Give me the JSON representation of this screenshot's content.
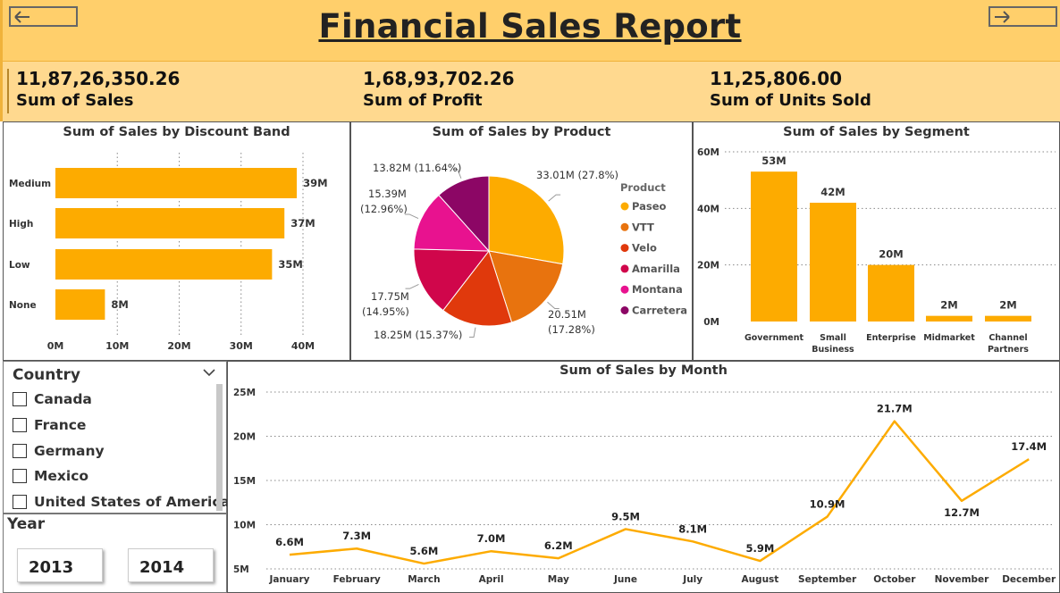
{
  "header": {
    "title": "Financial Sales Report",
    "back_icon": "arrow-left-icon",
    "forward_icon": "arrow-right-icon",
    "background_color": "#ffcf6b"
  },
  "kpis": [
    {
      "value": "11,87,26,350.26",
      "label": "Sum of Sales"
    },
    {
      "value": "1,68,93,702.26",
      "label": "Sum of Profit"
    },
    {
      "value": "11,25,806.00",
      "label": "Sum of Units Sold"
    }
  ],
  "colors": {
    "accent": "#fdab00",
    "product_palette": [
      "#fdab00",
      "#e8730e",
      "#e0390c",
      "#d0064b",
      "#e8128f",
      "#8c0665"
    ]
  },
  "chart_data": [
    {
      "type": "bar",
      "orientation": "horizontal",
      "title": "Sum of Sales by Discount Band",
      "categories": [
        "Medium",
        "High",
        "Low",
        "None"
      ],
      "values": [
        39,
        37,
        35,
        8
      ],
      "data_labels": [
        "39M",
        "37M",
        "35M",
        "8M"
      ],
      "x_ticks": [
        "0M",
        "10M",
        "20M",
        "30M",
        "40M"
      ],
      "xlim": [
        0,
        40
      ],
      "unit": "M",
      "grid": true
    },
    {
      "type": "pie",
      "title": "Sum of Sales by Product",
      "legend_title": "Product",
      "legend_position": "right",
      "slices": [
        {
          "name": "Paseo",
          "value": 33.01,
          "label_value": "33.01M",
          "label_pct": "(27.8%)"
        },
        {
          "name": "VTT",
          "value": 20.51,
          "label_value": "20.51M",
          "label_pct": "(17.28%)"
        },
        {
          "name": "Velo",
          "value": 18.25,
          "label_value": "18.25M",
          "label_pct": "(15.37%)"
        },
        {
          "name": "Amarilla",
          "value": 17.75,
          "label_value": "17.75M",
          "label_pct": "(14.95%)"
        },
        {
          "name": "Montana",
          "value": 15.39,
          "label_value": "15.39M",
          "label_pct": "(12.96%)"
        },
        {
          "name": "Carretera",
          "value": 13.82,
          "label_value": "13.82M",
          "label_pct": "(11.64%)"
        }
      ]
    },
    {
      "type": "bar",
      "title": "Sum of Sales by Segment",
      "categories": [
        "Government",
        "Small Business",
        "Enterprise",
        "Midmarket",
        "Channel Partners"
      ],
      "values": [
        53,
        42,
        20,
        2,
        2
      ],
      "data_labels": [
        "53M",
        "42M",
        "20M",
        "2M",
        "2M"
      ],
      "y_ticks": [
        "0M",
        "20M",
        "40M",
        "60M"
      ],
      "ylim": [
        0,
        60
      ],
      "grid": true
    },
    {
      "type": "line",
      "title": "Sum of Sales by Month",
      "categories": [
        "January",
        "February",
        "March",
        "April",
        "May",
        "June",
        "July",
        "August",
        "September",
        "October",
        "November",
        "December"
      ],
      "values": [
        6.6,
        7.3,
        5.6,
        7.0,
        6.2,
        9.5,
        8.1,
        5.9,
        10.9,
        21.7,
        12.7,
        17.4
      ],
      "data_labels": [
        "6.6M",
        "7.3M",
        "5.6M",
        "7.0M",
        "6.2M",
        "9.5M",
        "8.1M",
        "5.9M",
        "10.9M",
        "21.7M",
        "12.7M",
        "17.4M"
      ],
      "y_ticks": [
        "5M",
        "10M",
        "15M",
        "20M",
        "25M"
      ],
      "ylim": [
        5,
        25
      ],
      "grid": true
    }
  ],
  "country_slicer": {
    "title": "Country",
    "items": [
      "Canada",
      "France",
      "Germany",
      "Mexico",
      "United States of America"
    ]
  },
  "year_slicer": {
    "title": "Year",
    "options": [
      "2013",
      "2014"
    ]
  }
}
